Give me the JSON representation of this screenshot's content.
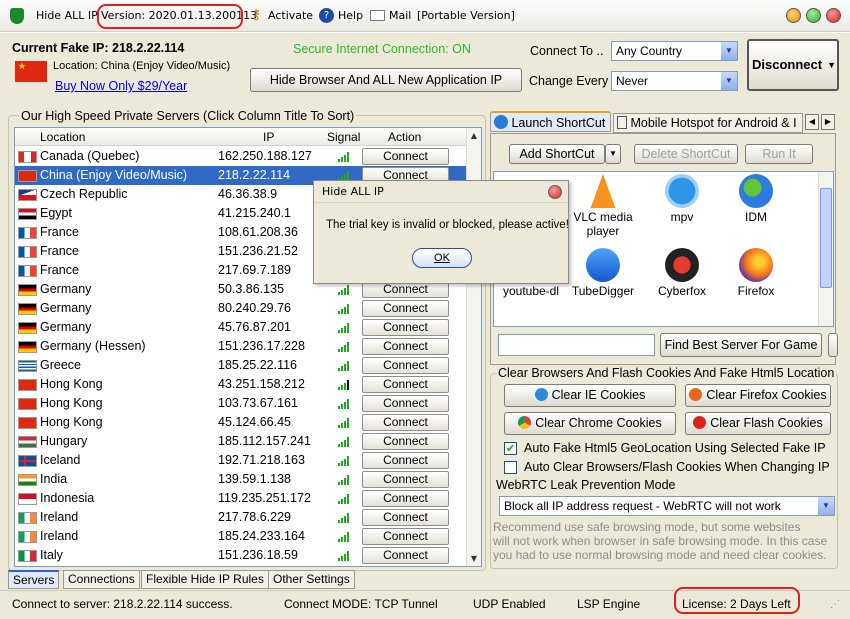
{
  "title": {
    "app": "Hide ALL IP",
    "version": "Version: 2020.01.13.200113",
    "activate": "Activate",
    "help": "Help",
    "mail": "Mail",
    "portable": "[Portable Version]"
  },
  "header": {
    "current_ip_label": "Current Fake IP: 218.2.22.114",
    "location": "Location: China (Enjoy Video/Music)",
    "buy_link": "Buy Now Only $29/Year",
    "secure": "Secure Internet Connection: ON",
    "hide_button": "Hide Browser And ALL New Application IP",
    "connect_to_label": "Connect To ..",
    "connect_to_value": "Any Country",
    "change_every_label": "Change Every",
    "change_every_value": "Never",
    "disconnect": "Disconnect",
    "secure_color": "#2fb52f",
    "link_color": "#0000ee"
  },
  "servers": {
    "group_title": "Our High Speed Private Servers (Click Column Title To Sort)",
    "columns": [
      "Location",
      "IP",
      "Signal",
      "Action"
    ],
    "connect_label": "Connect",
    "rows": [
      {
        "location": "Canada (Quebec)",
        "ip": "162.250.188.127",
        "flag": "canada"
      },
      {
        "location": "China (Enjoy Video/Music)",
        "ip": "218.2.22.114",
        "flag": "china"
      },
      {
        "location": "Czech Republic",
        "ip": "46.36.38.9",
        "flag": "czech"
      },
      {
        "location": "Egypt",
        "ip": "41.215.240.1",
        "flag": "egypt"
      },
      {
        "location": "France",
        "ip": "108.61.208.36",
        "flag": "france"
      },
      {
        "location": "France",
        "ip": "151.236.21.52",
        "flag": "france"
      },
      {
        "location": "France",
        "ip": "217.69.7.189",
        "flag": "france"
      },
      {
        "location": "Germany",
        "ip": "50.3.86.135",
        "flag": "germany"
      },
      {
        "location": "Germany",
        "ip": "80.240.29.76",
        "flag": "germany"
      },
      {
        "location": "Germany",
        "ip": "45.76.87.201",
        "flag": "germany"
      },
      {
        "location": "Germany (Hessen)",
        "ip": "151.236.17.228",
        "flag": "germany"
      },
      {
        "location": "Greece",
        "ip": "185.25.22.116",
        "flag": "greece"
      },
      {
        "location": "Hong Kong",
        "ip": "43.251.158.212",
        "flag": "hongkong"
      },
      {
        "location": "Hong Kong",
        "ip": "103.73.67.161",
        "flag": "hongkong"
      },
      {
        "location": "Hong Kong",
        "ip": "45.124.66.45",
        "flag": "hongkong"
      },
      {
        "location": "Hungary",
        "ip": "185.112.157.241",
        "flag": "hungary"
      },
      {
        "location": "Iceland",
        "ip": "192.71.218.163",
        "flag": "iceland"
      },
      {
        "location": "India",
        "ip": "139.59.1.138",
        "flag": "india"
      },
      {
        "location": "Indonesia",
        "ip": "119.235.251.172",
        "flag": "indonesia"
      },
      {
        "location": "Ireland",
        "ip": "217.78.6.229",
        "flag": "ireland"
      },
      {
        "location": "Ireland",
        "ip": "185.24.233.164",
        "flag": "ireland"
      },
      {
        "location": "Italy",
        "ip": "151.236.18.59",
        "flag": "italy"
      }
    ]
  },
  "tabs": {
    "bottom": [
      "Servers",
      "Connections",
      "Flexible Hide IP Rules",
      "Other Settings"
    ]
  },
  "shortcuts": {
    "tab_launch": "Launch ShortCut",
    "tab_mobile": "Mobile Hotspot for Android & I",
    "add": "Add ShortCut",
    "delete": "Delete ShortCut",
    "run": "Run It",
    "apps": [
      {
        "name": "VLC media player",
        "icon": "vlc-icon"
      },
      {
        "name": "mpv",
        "icon": "mpv-icon"
      },
      {
        "name": "IDM",
        "icon": "idm-icon"
      },
      {
        "name": "youtube-dl",
        "icon": "youtube-dl-icon"
      },
      {
        "name": "TubeDigger",
        "icon": "tubedigger-icon"
      },
      {
        "name": "Cyberfox",
        "icon": "cyberfox-icon"
      },
      {
        "name": "Firefox",
        "icon": "firefox-icon"
      }
    ],
    "find_game": "Find Best Server For Game"
  },
  "cookies": {
    "group_title": "Clear Browsers And Flash Cookies And Fake Html5 Location",
    "clear_ie": "Clear IE Cookies",
    "clear_firefox": "Clear Firefox Cookies",
    "clear_chrome": "Clear Chrome Cookies",
    "clear_flash": "Clear Flash Cookies",
    "auto_geo": "Auto Fake Html5 GeoLocation Using Selected Fake IP",
    "auto_clear": "Auto Clear Browsers/Flash Cookies When Changing IP",
    "webrtc_label": "WebRTC Leak Prevention Mode",
    "webrtc_value": "Block all IP address request - WebRTC will not work",
    "recommend": [
      "Recommend use safe browsing mode, but some websites",
      "will not work when browser in safe browsing mode. In this case",
      "you had to use normal browsing mode and need clear cookies."
    ]
  },
  "dialog": {
    "title": "Hide ALL IP",
    "message": "The trial key is invalid or blocked, please active!",
    "ok": "OK"
  },
  "status": {
    "connect": "Connect to server: 218.2.22.114 success.",
    "mode": "Connect MODE: TCP Tunnel",
    "udp": "UDP Enabled",
    "lsp": "LSP Engine",
    "license": "License: 2 Days Left"
  }
}
